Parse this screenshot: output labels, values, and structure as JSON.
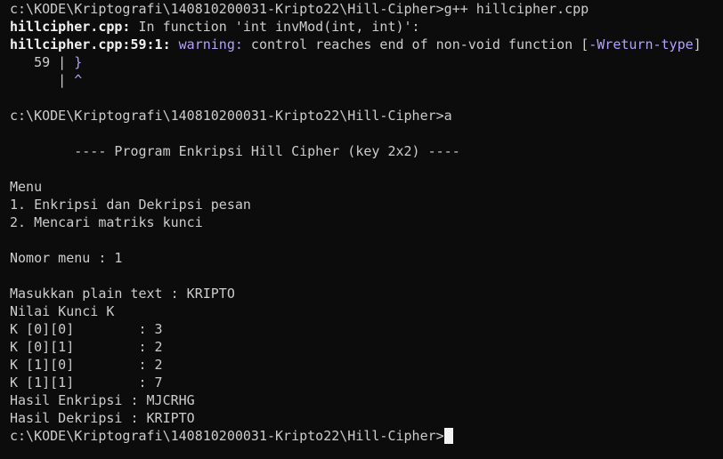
{
  "colors": {
    "background": "#0c0c0c",
    "text": "#cccccc",
    "bright": "#f2f2f2",
    "accent": "#b4a0ff"
  },
  "lines": {
    "l0_prompt": "c:\\KODE\\Kriptografi\\140810200031-Kripto22\\Hill-Cipher>g++ hillcipher.cpp",
    "l1_file": "hillcipher.cpp:",
    "l1_rest": " In function 'int invMod(int, int)':",
    "l2_file": "hillcipher.cpp:59:1:",
    "l2_warning": " warning:",
    "l2_msg": " control reaches end of non-void function [",
    "l2_flag": "-Wreturn-type",
    "l2_close": "]",
    "l3_lineno": "   59 | ",
    "l3_code": "}",
    "l4_bar": "      | ",
    "l4_caret": "^",
    "l6_prompt": "c:\\KODE\\Kriptografi\\140810200031-Kripto22\\Hill-Cipher>a",
    "l8_banner": "        ---- Program Enkripsi Hill Cipher (key 2x2) ----",
    "l10_menu": "Menu",
    "l11_opt1": "1. Enkripsi dan Dekripsi pesan",
    "l12_opt2": "2. Mencari matriks kunci",
    "l14_choice": "Nomor menu : 1",
    "l16_plain": "Masukkan plain text : KRIPTO",
    "l17_key": "Nilai Kunci K",
    "l18_k00": "K [0][0]        : 3",
    "l19_k01": "K [0][1]        : 2",
    "l20_k10": "K [1][0]        : 2",
    "l21_k11": "K [1][1]        : 7",
    "l22_enc": "Hasil Enkripsi : MJCRHG",
    "l23_dec": "Hasil Dekripsi : KRIPTO",
    "l24_prompt": "c:\\KODE\\Kriptografi\\140810200031-Kripto22\\Hill-Cipher>"
  }
}
